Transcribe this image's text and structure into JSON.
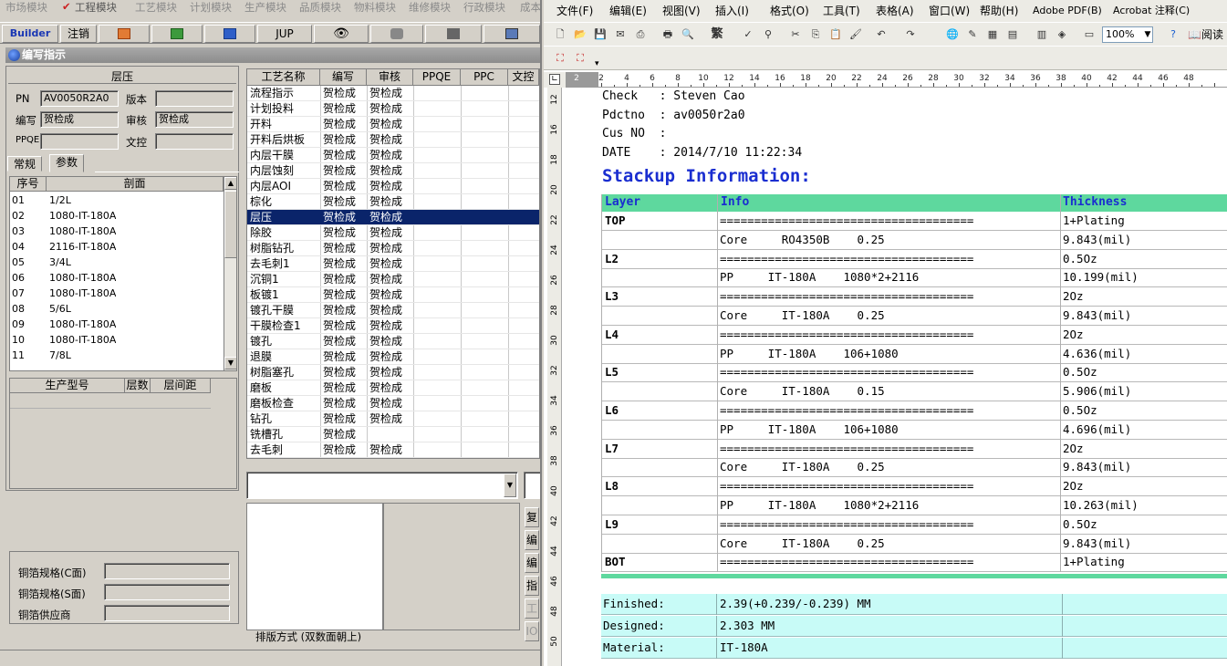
{
  "left_app": {
    "modules": [
      "市场模块",
      "工程模块",
      "工艺模块",
      "计划模块",
      "生产模块",
      "品质模块",
      "物料模块",
      "维修模块",
      "行政模块",
      "成本"
    ],
    "toolbar": {
      "builder": "Builder",
      "logout": "注销",
      "jup": "JUP"
    },
    "window_title": "编写指示",
    "group_title": "层压",
    "fields": {
      "pn_label": "PN",
      "pn_value": "AV0050R2A0",
      "version_label": "版本",
      "version_value": "",
      "writer_label": "编写",
      "writer_value": "贺检成",
      "reviewer_label": "审核",
      "reviewer_value": "贺检成",
      "ppqe_label": "PPQE",
      "ppqe_value": "",
      "doc_label": "文控",
      "doc_value": ""
    },
    "tabs": [
      "常规",
      "参数"
    ],
    "section_table": {
      "headers": [
        "序号",
        "剖面"
      ],
      "rows": [
        [
          "01",
          "1/2L"
        ],
        [
          "02",
          "1080-IT-180A"
        ],
        [
          "03",
          "1080-IT-180A"
        ],
        [
          "04",
          "2116-IT-180A"
        ],
        [
          "05",
          "3/4L"
        ],
        [
          "06",
          "1080-IT-180A"
        ],
        [
          "07",
          "1080-IT-180A"
        ],
        [
          "08",
          "5/6L"
        ],
        [
          "09",
          "1080-IT-180A"
        ],
        [
          "10",
          "1080-IT-180A"
        ],
        [
          "11",
          "7/8L"
        ]
      ]
    },
    "prod_table": {
      "headers": [
        "生产型号",
        "层数",
        "层间距"
      ]
    },
    "copper": {
      "c_label": "铜箔规格(C面)",
      "s_label": "铜箔规格(S面)",
      "supplier_label": "铜箔供应商"
    },
    "process_table": {
      "headers": [
        "工艺名称",
        "编写",
        "审核",
        "PPQE",
        "PPC",
        "文控"
      ],
      "rows": [
        [
          "流程指示",
          "贺检成",
          "贺检成"
        ],
        [
          "计划投料",
          "贺检成",
          "贺检成"
        ],
        [
          "开料",
          "贺检成",
          "贺检成"
        ],
        [
          "开料后烘板",
          "贺检成",
          "贺检成"
        ],
        [
          "内层干膜",
          "贺检成",
          "贺检成"
        ],
        [
          "内层蚀刻",
          "贺检成",
          "贺检成"
        ],
        [
          "内层AOI",
          "贺检成",
          "贺检成"
        ],
        [
          "棕化",
          "贺检成",
          "贺检成"
        ],
        [
          "层压",
          "贺检成",
          "贺检成"
        ],
        [
          "除胶",
          "贺检成",
          "贺检成"
        ],
        [
          "树脂钻孔",
          "贺检成",
          "贺检成"
        ],
        [
          "去毛刺1",
          "贺检成",
          "贺检成"
        ],
        [
          "沉铜1",
          "贺检成",
          "贺检成"
        ],
        [
          "板镀1",
          "贺检成",
          "贺检成"
        ],
        [
          "镀孔干膜",
          "贺检成",
          "贺检成"
        ],
        [
          "干膜检查1",
          "贺检成",
          "贺检成"
        ],
        [
          "镀孔",
          "贺检成",
          "贺检成"
        ],
        [
          "退膜",
          "贺检成",
          "贺检成"
        ],
        [
          "树脂塞孔",
          "贺检成",
          "贺检成"
        ],
        [
          "磨板",
          "贺检成",
          "贺检成"
        ],
        [
          "磨板检查",
          "贺检成",
          "贺检成"
        ],
        [
          "钻孔",
          "贺检成",
          "贺检成"
        ],
        [
          "铣槽孔",
          "贺检成",
          ""
        ],
        [
          "去毛刺",
          "贺检成",
          "贺检成"
        ]
      ]
    },
    "side_buttons": [
      "复",
      "编",
      "编",
      "指",
      "工",
      "IO"
    ],
    "layout_label": "排版方式 (双数面朝上)"
  },
  "word": {
    "menus": [
      "文件(F)",
      "编辑(E)",
      "视图(V)",
      "插入(I)",
      "格式(O)",
      "工具(T)",
      "表格(A)",
      "窗口(W)",
      "帮助(H)",
      "Adobe PDF(B)",
      "Acrobat 注释(C)"
    ],
    "zoom": "100%",
    "read": "阅读",
    "traditional": "繁",
    "ruler_numbers": [
      "2",
      "2",
      "4",
      "6",
      "8",
      "10",
      "12",
      "14",
      "16",
      "18",
      "20",
      "22",
      "24",
      "26",
      "28",
      "30",
      "32",
      "34",
      "36",
      "38",
      "40",
      "42",
      "44",
      "46",
      "48"
    ],
    "vruler_numbers": [
      "12",
      "16",
      "18",
      "20",
      "22",
      "24",
      "26",
      "28",
      "30",
      "32",
      "34",
      "36",
      "38",
      "40",
      "42",
      "44",
      "46",
      "48",
      "50"
    ],
    "header_lines": [
      "Check   : Steven Cao",
      "Pdctno  : av0050r2a0",
      "Cus NO  :",
      "DATE    : 2014/7/10 11:22:34"
    ],
    "title": "Stackup Information:",
    "col_layer": "Layer",
    "col_info": "Info",
    "col_thickness": "Thickness",
    "stack_rows": [
      {
        "layer": "TOP",
        "info": "=====================================",
        "thick": "1+Plating"
      },
      {
        "layer": "",
        "info": "Core     RO4350B    0.25",
        "thick": "9.843(mil)"
      },
      {
        "layer": "L2",
        "info": "=====================================",
        "thick": "0.5Oz"
      },
      {
        "layer": "",
        "info": "PP     IT-180A    1080*2+2116",
        "thick": "10.199(mil)"
      },
      {
        "layer": "L3",
        "info": "=====================================",
        "thick": "2Oz"
      },
      {
        "layer": "",
        "info": "Core     IT-180A    0.25",
        "thick": "9.843(mil)"
      },
      {
        "layer": "L4",
        "info": "=====================================",
        "thick": "2Oz"
      },
      {
        "layer": "",
        "info": "PP     IT-180A    106+1080",
        "thick": "4.636(mil)"
      },
      {
        "layer": "L5",
        "info": "=====================================",
        "thick": "0.5Oz"
      },
      {
        "layer": "",
        "info": "Core     IT-180A    0.15",
        "thick": "5.906(mil)"
      },
      {
        "layer": "L6",
        "info": "=====================================",
        "thick": "0.5Oz"
      },
      {
        "layer": "",
        "info": "PP     IT-180A    106+1080",
        "thick": "4.696(mil)"
      },
      {
        "layer": "L7",
        "info": "=====================================",
        "thick": "2Oz"
      },
      {
        "layer": "",
        "info": "Core     IT-180A    0.25",
        "thick": "9.843(mil)"
      },
      {
        "layer": "L8",
        "info": "=====================================",
        "thick": "2Oz"
      },
      {
        "layer": "",
        "info": "PP     IT-180A    1080*2+2116",
        "thick": "10.263(mil)"
      },
      {
        "layer": "L9",
        "info": "=====================================",
        "thick": "0.5Oz"
      },
      {
        "layer": "",
        "info": "Core     IT-180A    0.25",
        "thick": "9.843(mil)"
      },
      {
        "layer": "BOT",
        "info": "=====================================",
        "thick": "1+Plating"
      }
    ],
    "footer_rows": [
      {
        "label": "Finished:",
        "value": "2.39(+0.239/-0.239) MM"
      },
      {
        "label": "Designed:",
        "value": "2.303 MM"
      },
      {
        "label": "Material:",
        "value": "IT-180A"
      }
    ]
  }
}
